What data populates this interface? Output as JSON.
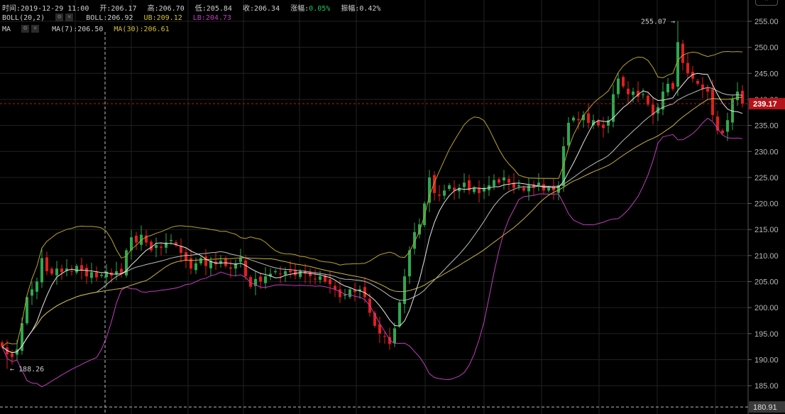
{
  "header": {
    "time_label": "时间:2019-12-29 11:00",
    "open_label": "开:206.17",
    "high_label": "高:206.70",
    "low_label": "低:205.84",
    "close_label": "收:206.34",
    "change_label": "涨幅:",
    "change_value": "0.05%",
    "amplitude_label": "振幅:0.42%"
  },
  "boll_legend": {
    "name": "BOLL(20,2)",
    "mid": "BOLL:206.92",
    "ub": "UB:209.12",
    "lb": "LB:204.73"
  },
  "ma_legend": {
    "name": "MA",
    "ma7": "MA(7):206.50",
    "ma30": "MA(30):206.61"
  },
  "icons": {
    "settings": "gear-icon",
    "close": "close-icon",
    "collapse": "chevron-up-icon"
  },
  "colors": {
    "up": "#2fa84f",
    "down": "#e0201c",
    "ma7": "#e8e8e8",
    "ma30": "#c9b53a",
    "boll_mid": "#bdbdbd",
    "boll_ub": "#b9a424",
    "boll_lb": "#c23cc0",
    "last_price": "#b3141a",
    "grid": "#222222",
    "change": "#22c55e"
  },
  "chart_data": {
    "type": "candlestick",
    "title": "",
    "y_ticks": [
      255,
      250,
      245,
      240,
      235,
      230,
      225,
      220,
      215,
      210,
      205,
      200,
      195,
      190,
      185
    ],
    "ylim": [
      180.91,
      256.5
    ],
    "grid": true,
    "last_price": "239.17",
    "crosshair_price": "180.91",
    "max_annotation": {
      "value": "255.07",
      "index": 136
    },
    "min_annotation": {
      "value": "188.26",
      "index": 1
    },
    "indicators": [
      "MA(7)",
      "MA(30)",
      "BOLL(20,2)"
    ],
    "closes": [
      192.5,
      191,
      190.5,
      192,
      197,
      202,
      203.5,
      205,
      209.5,
      207,
      206.5,
      207.5,
      206.8,
      207.5,
      206.9,
      208,
      207.2,
      206,
      206.8,
      205.8,
      206.3,
      206.9,
      206.2,
      207,
      206.5,
      211,
      213.5,
      212.5,
      214,
      212.5,
      211,
      212,
      211.5,
      212.5,
      213,
      212,
      210.5,
      209,
      207.5,
      208.5,
      209.5,
      208,
      209,
      208.3,
      209,
      208,
      207.5,
      208.5,
      209.5,
      206,
      204,
      205.5,
      205,
      206,
      206.5,
      207,
      206.5,
      207,
      206.8,
      206.2,
      207,
      206.5,
      206,
      205.5,
      206,
      205,
      204.5,
      203.5,
      202,
      202.5,
      203.5,
      203,
      203.5,
      202,
      199,
      196.5,
      195,
      194.5,
      193,
      196,
      201,
      206,
      211,
      214.5,
      216,
      220,
      225,
      222,
      221.5,
      222.5,
      223.5,
      222.5,
      223,
      224,
      222.5,
      223,
      222,
      223,
      223.5,
      224.5,
      224,
      225,
      224,
      223,
      223.5,
      222.5,
      223.5,
      223,
      224,
      222.5,
      223,
      222.5,
      223.5,
      231,
      235.5,
      236.5,
      236,
      237,
      235.5,
      236,
      235,
      234.5,
      236,
      241,
      244,
      242.5,
      241,
      241.5,
      240.5,
      241,
      239,
      237,
      238.5,
      241.5,
      243,
      242,
      251,
      247,
      245,
      244,
      243,
      242,
      241.5,
      237,
      234,
      233.5,
      236,
      240,
      241.5,
      239.17
    ]
  }
}
